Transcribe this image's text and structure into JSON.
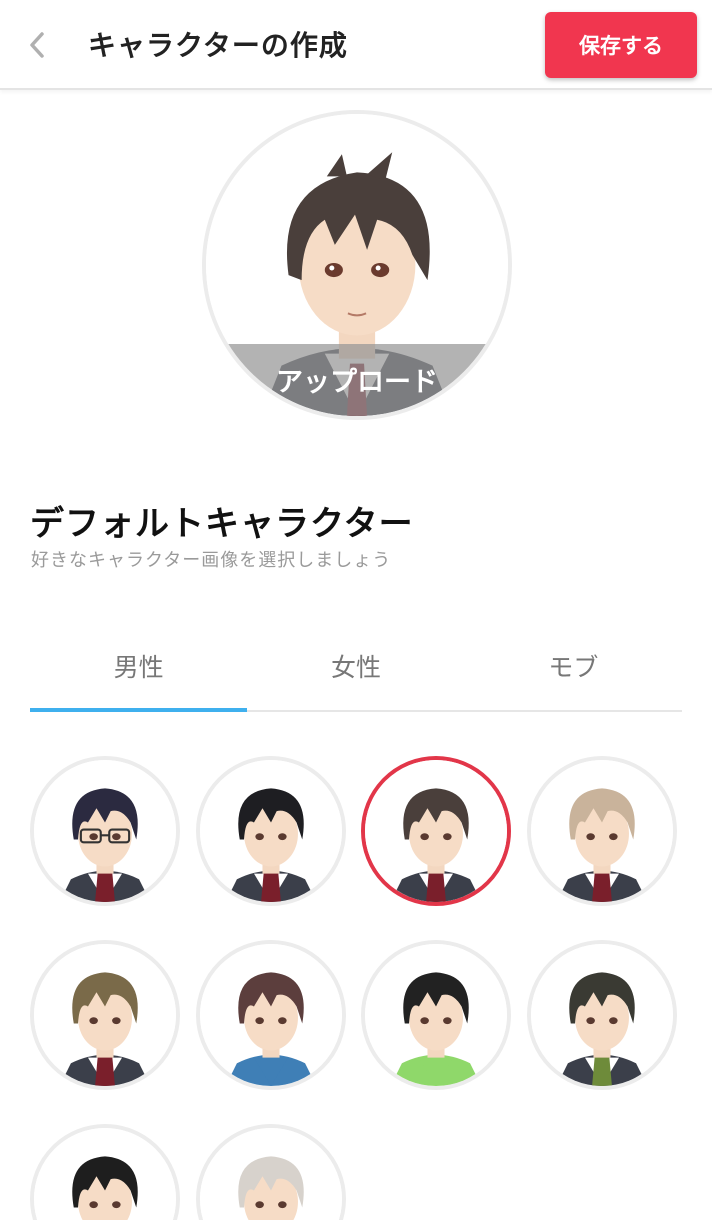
{
  "header": {
    "title": "キャラクターの作成",
    "save_label": "保存する",
    "back_icon": "chevron-left-icon"
  },
  "avatar": {
    "upload_label": "アップロード"
  },
  "section": {
    "title": "デフォルトキャラクター",
    "subtitle": "好きなキャラクター画像を選択しましょう"
  },
  "tabs": [
    {
      "label": "男性",
      "active": true
    },
    {
      "label": "女性",
      "active": false
    },
    {
      "label": "モブ",
      "active": false
    }
  ],
  "characters": [
    {
      "hair": "#2b2a40",
      "glasses": true,
      "shirt": "#ffffff",
      "tie": "#7a1f2b",
      "selected": false
    },
    {
      "hair": "#1e1e22",
      "glasses": false,
      "shirt": "#ffffff",
      "tie": "#7a1f2b",
      "selected": false
    },
    {
      "hair": "#4a3f3b",
      "glasses": false,
      "shirt": "#ffffff",
      "tie": "#7a1f2b",
      "selected": true
    },
    {
      "hair": "#c9b39b",
      "glasses": false,
      "shirt": "#ffffff",
      "tie": "#7a1f2b",
      "selected": false
    },
    {
      "hair": "#7a6a49",
      "glasses": false,
      "shirt": "#ffffff",
      "tie": "#7a1f2b",
      "selected": false
    },
    {
      "hair": "#5c3e3d",
      "glasses": false,
      "shirt": "#3f7fb6",
      "tie": "",
      "selected": false
    },
    {
      "hair": "#222222",
      "glasses": false,
      "shirt": "#8fd86a",
      "tie": "",
      "selected": false
    },
    {
      "hair": "#3a3a33",
      "glasses": false,
      "shirt": "#ffffff",
      "tie": "#6e8b3a",
      "selected": false
    },
    {
      "hair": "#1e1e1e",
      "glasses": false,
      "shirt": "#ffffff",
      "tie": "",
      "selected": false
    },
    {
      "hair": "#d7d2cc",
      "glasses": false,
      "shirt": "#ffffff",
      "tie": "",
      "selected": false
    }
  ],
  "colors": {
    "accent": "#f1364f",
    "tab_indicator": "#3fb0ee",
    "selected_ring": "#e23649"
  }
}
